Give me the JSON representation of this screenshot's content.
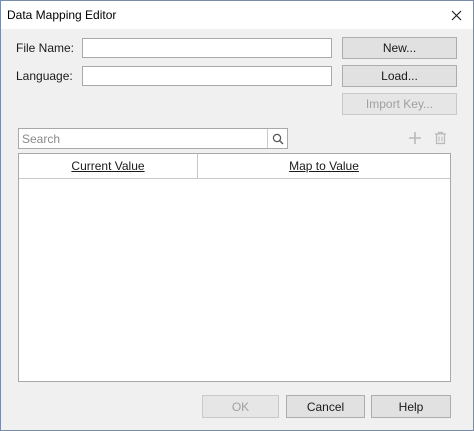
{
  "window": {
    "title": "Data Mapping Editor"
  },
  "form": {
    "file_name_label": "File Name:",
    "file_name_value": "",
    "language_label": "Language:",
    "language_value": ""
  },
  "side_buttons": {
    "new_label": "New...",
    "load_label": "Load...",
    "import_key_label": "Import Key..."
  },
  "search": {
    "placeholder": "Search",
    "value": ""
  },
  "toolbar": {
    "add_icon": "plus-icon",
    "delete_icon": "trash-icon"
  },
  "table": {
    "columns": [
      "Current Value",
      "Map to Value"
    ],
    "rows": []
  },
  "footer": {
    "ok_label": "OK",
    "cancel_label": "Cancel",
    "help_label": "Help"
  },
  "colors": {
    "window_border": "#7a8ba8",
    "dialog_bg": "#f0f0f0",
    "button_bg": "#e1e1e1",
    "disabled_text": "#a0a0a0"
  }
}
